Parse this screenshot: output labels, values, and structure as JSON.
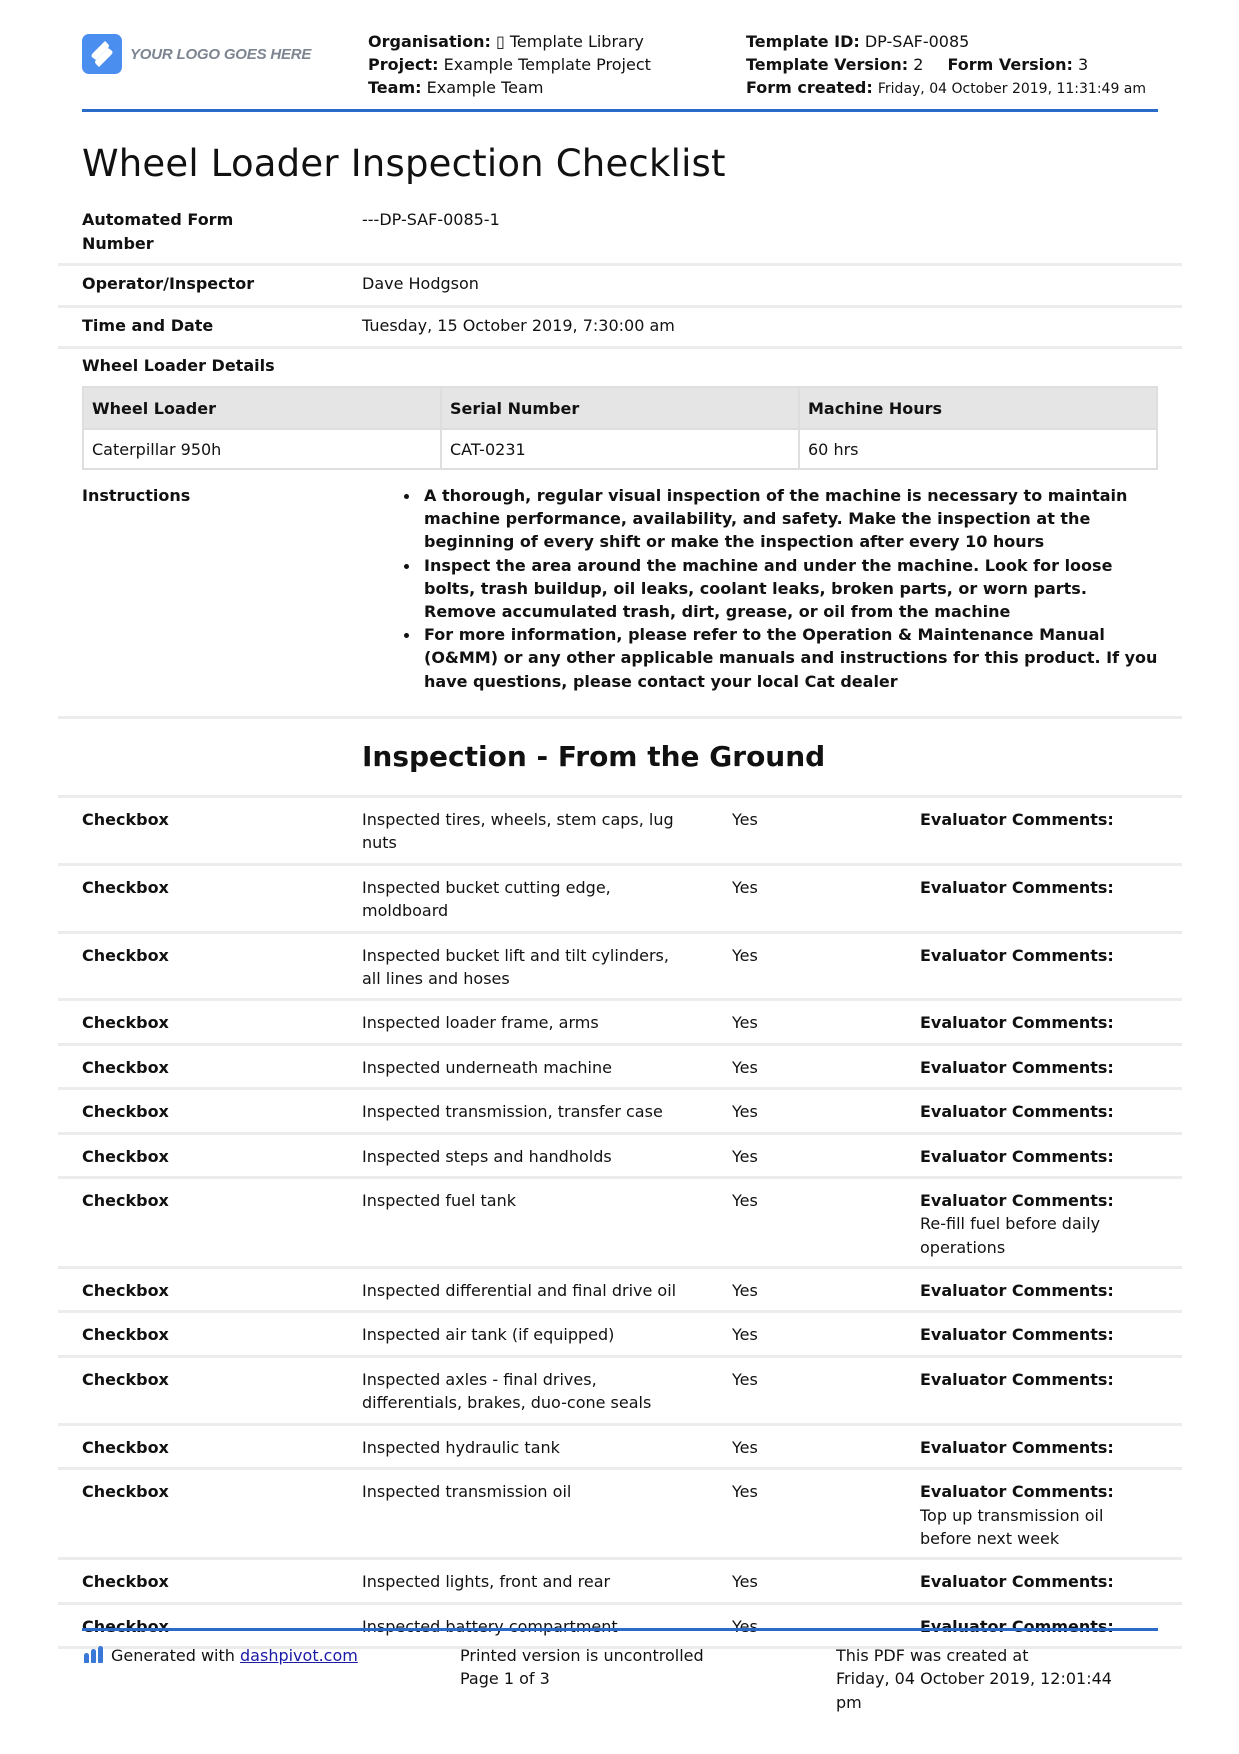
{
  "header": {
    "logo_text": "YOUR LOGO GOES HERE",
    "organisation_label": "Organisation:",
    "organisation_value": "▯ Template Library",
    "project_label": "Project:",
    "project_value": "Example Template Project",
    "team_label": "Team:",
    "team_value": "Example Team",
    "template_id_label": "Template ID:",
    "template_id_value": "DP-SAF-0085",
    "template_version_label": "Template Version:",
    "template_version_value": "2",
    "form_version_label": "Form Version:",
    "form_version_value": "3",
    "form_created_label": "Form created:",
    "form_created_value": "Friday, 04 October 2019, 11:31:49 am"
  },
  "title": "Wheel Loader Inspection Checklist",
  "fields": [
    {
      "label": "Automated Form Number",
      "value": "---DP-SAF-0085-1"
    },
    {
      "label": "Operator/Inspector",
      "value": "Dave Hodgson"
    },
    {
      "label": "Time and Date",
      "value": "Tuesday, 15 October 2019, 7:30:00 am"
    }
  ],
  "details": {
    "label": "Wheel Loader Details",
    "columns": [
      "Wheel Loader",
      "Serial Number",
      "Machine Hours"
    ],
    "row": [
      "Caterpillar 950h",
      "CAT-0231",
      "60 hrs"
    ]
  },
  "instructions": {
    "label": "Instructions",
    "items": [
      "A thorough, regular visual inspection of the machine is necessary to maintain machine performance, availability, and safety. Make the inspection at the beginning of every shift or make the inspection after every 10 hours",
      "Inspect the area around the machine and under the machine. Look for loose bolts, trash buildup, oil leaks, coolant leaks, broken parts, or worn parts. Remove accumulated trash, dirt, grease, or oil from the machine",
      "For more information, please refer to the Operation & Maintenance Manual (O&MM) or any other applicable manuals and instructions for this product. If you have questions, please contact your local Cat dealer"
    ]
  },
  "section": {
    "title": "Inspection - From the Ground",
    "checkbox_label": "Checkbox",
    "comments_label": "Evaluator Comments:",
    "items": [
      {
        "desc": "Inspected tires, wheels, stem caps, lug nuts",
        "answer": "Yes",
        "comment": ""
      },
      {
        "desc": "Inspected bucket cutting edge, moldboard",
        "answer": "Yes",
        "comment": ""
      },
      {
        "desc": "Inspected bucket lift and tilt cylinders, all lines and hoses",
        "answer": "Yes",
        "comment": ""
      },
      {
        "desc": "Inspected loader frame, arms",
        "answer": "Yes",
        "comment": ""
      },
      {
        "desc": "Inspected underneath machine",
        "answer": "Yes",
        "comment": ""
      },
      {
        "desc": "Inspected transmission, transfer case",
        "answer": "Yes",
        "comment": ""
      },
      {
        "desc": "Inspected steps and handholds",
        "answer": "Yes",
        "comment": ""
      },
      {
        "desc": "Inspected fuel tank",
        "answer": "Yes",
        "comment": "Re-fill fuel before daily operations"
      },
      {
        "desc": "Inspected differential and final drive oil",
        "answer": "Yes",
        "comment": ""
      },
      {
        "desc": "Inspected air tank (if equipped)",
        "answer": "Yes",
        "comment": ""
      },
      {
        "desc": "Inspected axles - final drives, differentials, brakes, duo-cone seals",
        "answer": "Yes",
        "comment": ""
      },
      {
        "desc": "Inspected hydraulic tank",
        "answer": "Yes",
        "comment": ""
      },
      {
        "desc": "Inspected transmission oil",
        "answer": "Yes",
        "comment": "Top up transmission oil before next week"
      },
      {
        "desc": "Inspected lights, front and rear",
        "answer": "Yes",
        "comment": ""
      },
      {
        "desc": "Inspected battery compartment",
        "answer": "Yes",
        "comment": ""
      }
    ]
  },
  "footer": {
    "generated_prefix": "Generated with",
    "generated_link": "dashpivot.com",
    "uncontrolled": "Printed version is uncontrolled",
    "page": "Page 1 of 3",
    "created_line1": "This PDF was created at",
    "created_line2": "Friday, 04 October 2019, 12:01:44 pm"
  },
  "colors": {
    "accent_rule": "#2a6bc9",
    "logo_blue": "#4a8ef0",
    "table_header_bg": "#e5e5e5",
    "link": "#1a1aa6"
  }
}
